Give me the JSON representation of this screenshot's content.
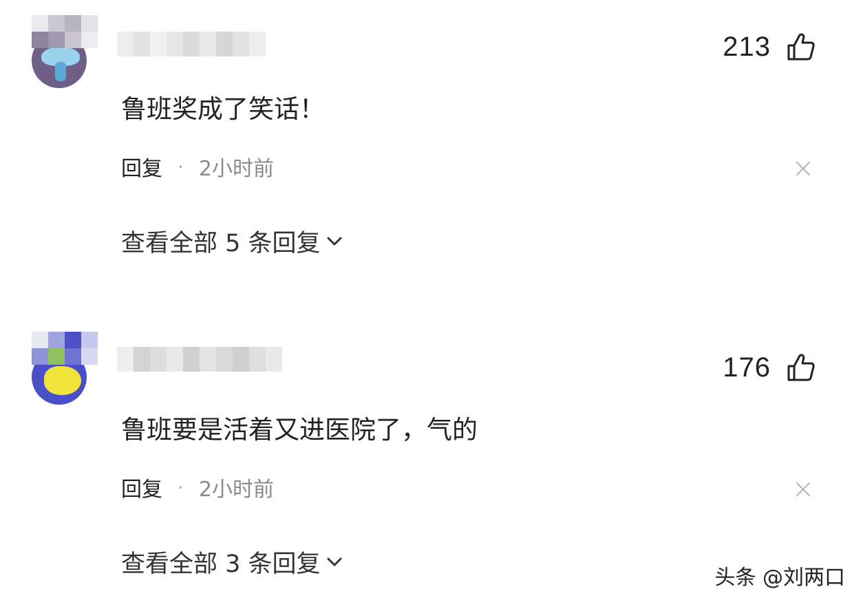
{
  "comments": [
    {
      "text": "鲁班奖成了笑话！",
      "likes": "213",
      "reply_label": "回复",
      "separator": "·",
      "time": "2小时前",
      "view_replies": "查看全部 5 条回复",
      "avatar_colors": {
        "background": "#6f5f86",
        "accent": "#9bd2ec"
      }
    },
    {
      "text": "鲁班要是活着又进医院了，气的",
      "likes": "176",
      "reply_label": "回复",
      "separator": "·",
      "time": "2小时前",
      "view_replies": "查看全部 3 条回复",
      "avatar_colors": {
        "background": "#4a4fc9",
        "accent": "#f2e33a"
      }
    }
  ],
  "icons": {
    "like": "thumbs-up-icon",
    "close": "close-icon",
    "expand": "chevron-down-icon"
  },
  "watermark": "头条 @刘两口"
}
